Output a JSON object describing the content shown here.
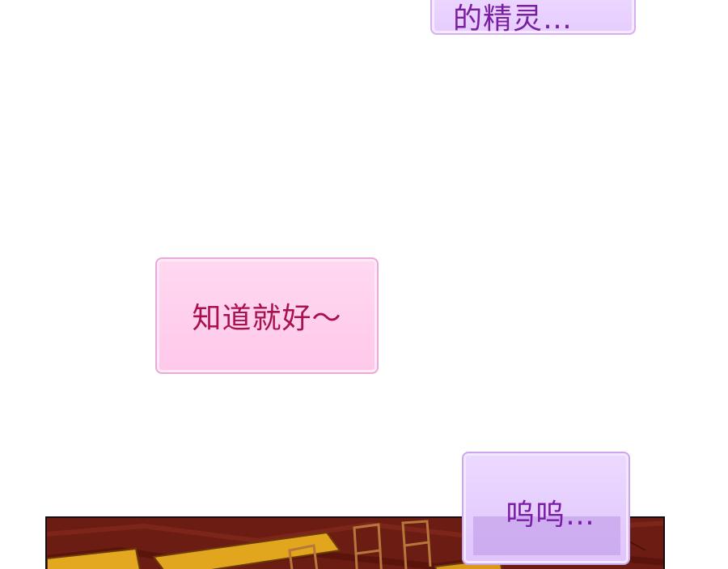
{
  "bubbles": {
    "top": {
      "text": "的精灵…"
    },
    "middle": {
      "text": "知道就好～"
    },
    "bottom": {
      "text": "呜呜…"
    }
  },
  "colors": {
    "background": "#ffffff",
    "purple_bubble_fill": "#e6ccff",
    "purple_text": "#7a1fa0",
    "pink_bubble_fill": "#ffc8ea",
    "pink_text": "#a8124c",
    "scene_floor": "#6e1d14",
    "scene_table": "#e2a61e"
  }
}
